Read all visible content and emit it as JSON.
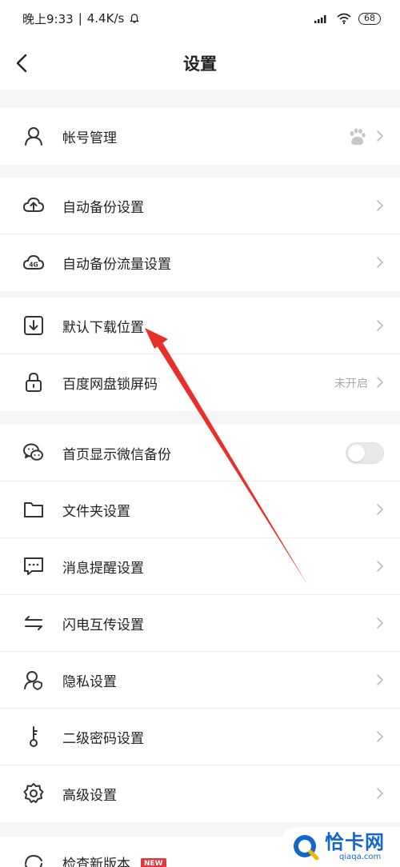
{
  "status": {
    "time": "晚上9:33",
    "speed": "4.4K/s",
    "battery": "68"
  },
  "header": {
    "title": "设置"
  },
  "groups": {
    "account": {
      "label": "帐号管理"
    },
    "backup": [
      {
        "label": "自动备份设置"
      },
      {
        "label": "自动备份流量设置"
      }
    ],
    "download": {
      "label": "默认下载位置"
    },
    "lock": {
      "label": "百度网盘锁屏码",
      "value": "未开启"
    },
    "misc": [
      {
        "label": "首页显示微信备份",
        "toggle": false
      },
      {
        "label": "文件夹设置"
      },
      {
        "label": "消息提醒设置"
      },
      {
        "label": "闪电互传设置"
      },
      {
        "label": "隐私设置"
      },
      {
        "label": "二级密码设置"
      },
      {
        "label": "高级设置"
      }
    ],
    "update": {
      "label": "检查新版本",
      "badge": "NEW"
    }
  },
  "watermark": {
    "cn": "恰卡网",
    "en": "qiaqa.com"
  },
  "colors": {
    "accent": "#1466c7",
    "arrow": "#e8302a",
    "badge": "#e4393c"
  }
}
